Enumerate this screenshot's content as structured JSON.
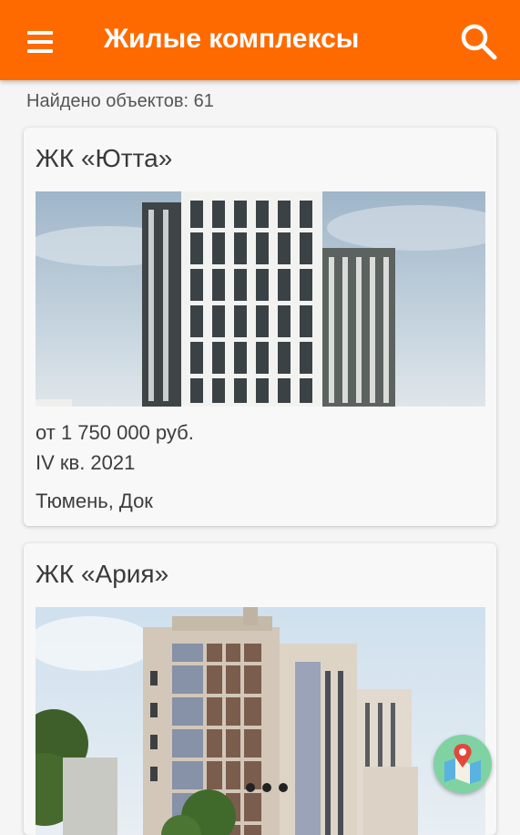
{
  "header": {
    "title": "Жилые комплексы",
    "background_color": "#ff6a00",
    "menu_icon": "menu-icon",
    "search_icon": "search-icon"
  },
  "results": {
    "count_label": "Найдено объектов: 61"
  },
  "cards": [
    {
      "title": "ЖК «Ютта»",
      "image": "building-photo",
      "price": "от 1 750 000 руб.",
      "completion": "IV кв. 2021",
      "location": "Тюмень, Док"
    },
    {
      "title": "ЖК «Ария»",
      "image": "building-photo"
    }
  ],
  "fab": {
    "icon": "map-icon",
    "color": "#7fd3a3"
  },
  "carousel": {
    "dot_count": 3
  }
}
